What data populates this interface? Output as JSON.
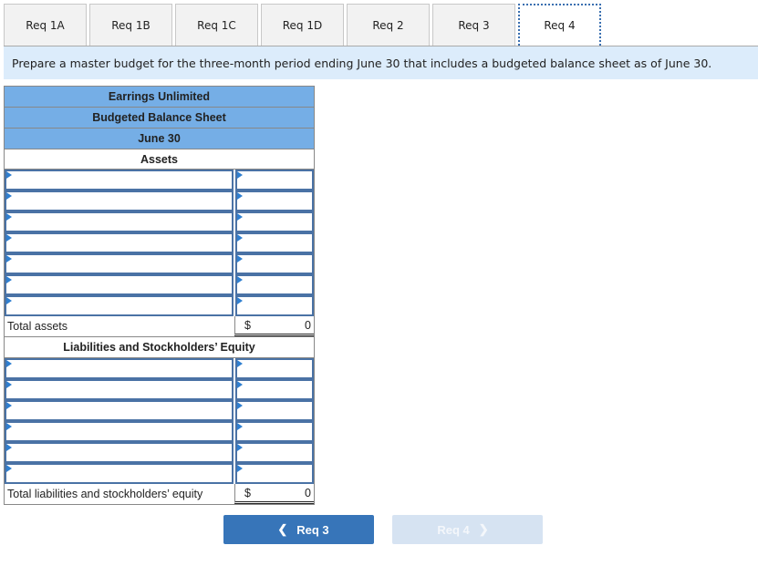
{
  "tabs": [
    {
      "label": "Req 1A",
      "active": false
    },
    {
      "label": "Req 1B",
      "active": false
    },
    {
      "label": "Req 1C",
      "active": false
    },
    {
      "label": "Req 1D",
      "active": false
    },
    {
      "label": "Req 2",
      "active": false
    },
    {
      "label": "Req 3",
      "active": false
    },
    {
      "label": "Req 4",
      "active": true
    }
  ],
  "instruction": "Prepare a master budget for the three-month period ending June 30 that includes a budgeted balance sheet as of June 30.",
  "sheet": {
    "company": "Earrings Unlimited",
    "title": "Budgeted Balance Sheet",
    "date": "June 30",
    "assets_heading": "Assets",
    "asset_rows": 7,
    "total_assets_label": "Total assets",
    "total_assets_currency": "$",
    "total_assets_value": "0",
    "liab_heading": "Liabilities and Stockholders’ Equity",
    "liab_rows": 6,
    "total_liab_label": "Total liabilities and stockholders’ equity",
    "total_liab_currency": "$",
    "total_liab_value": "0"
  },
  "nav": {
    "prev_label": "Req 3",
    "prev_icon": "chevron-left-icon",
    "next_label": "Req 4",
    "next_icon": "chevron-right-icon",
    "next_disabled": true
  }
}
